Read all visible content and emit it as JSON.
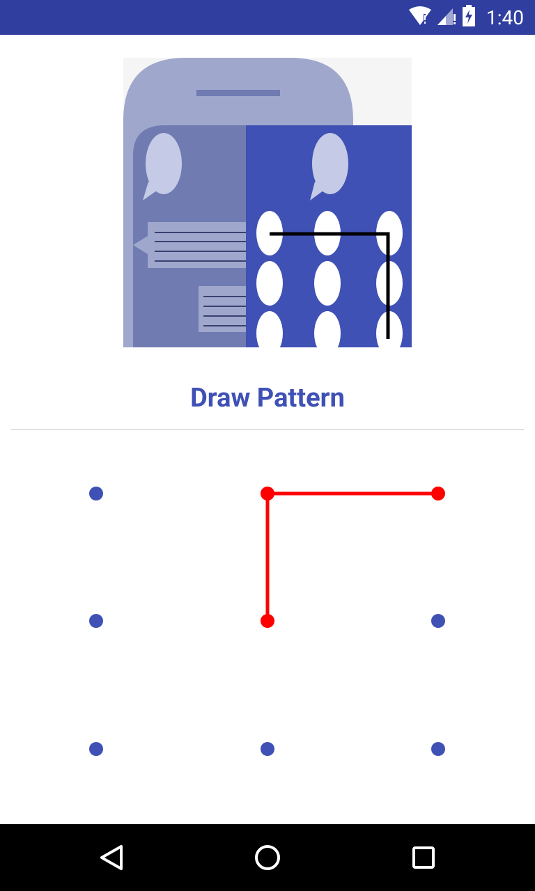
{
  "status_bar": {
    "time": "1:40",
    "icons": [
      "wifi-icon",
      "signal-icon",
      "battery-charging-icon"
    ]
  },
  "illustration": {
    "icon": "pattern-lock-illustration"
  },
  "title": "Draw Pattern",
  "pattern": {
    "grid_rows": 3,
    "grid_cols": 3,
    "selected_sequence": [
      2,
      1,
      4
    ],
    "colors": {
      "dot": "#3F51B5",
      "selected": "#FF0000"
    }
  },
  "navigation": {
    "back_icon": "back-icon",
    "home_icon": "home-icon",
    "recents_icon": "recents-icon"
  },
  "colors": {
    "primary_dark": "#303F9F",
    "primary": "#3F51B5"
  }
}
